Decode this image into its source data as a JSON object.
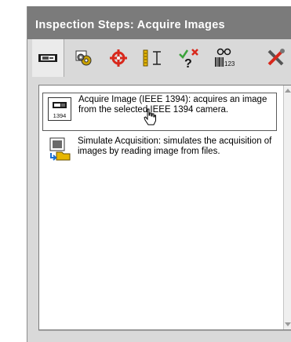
{
  "panel": {
    "title": "Inspection Steps: Acquire Images"
  },
  "toolbar": {
    "tabs": [
      {
        "name": "acquire-images",
        "icon": "camera-icon"
      },
      {
        "name": "enhance-images",
        "icon": "gears-icon"
      },
      {
        "name": "locate-features",
        "icon": "crosshair-icon"
      },
      {
        "name": "measure-features",
        "icon": "caliper-icon"
      },
      {
        "name": "check-for-presence",
        "icon": "check-question-icon"
      },
      {
        "name": "identify-parts",
        "icon": "glasses-barcode-icon"
      },
      {
        "name": "use-additional-tools",
        "icon": "tools-icon"
      }
    ],
    "barcode_text": "123"
  },
  "list": {
    "items": [
      {
        "label": "Acquire Image (IEEE 1394):  acquires an image from the selected IEEE 1394 camera.",
        "icon": "camera-1394-icon",
        "icon_caption": "1394",
        "selected": true
      },
      {
        "label": "Simulate Acquisition:  simulates the acquisition of images by reading image from files.",
        "icon": "folder-image-icon",
        "selected": false
      }
    ]
  },
  "colors": {
    "title_bar": "#7b7b7b",
    "panel_bg": "#d9d9d9",
    "list_bg": "#ffffff"
  }
}
